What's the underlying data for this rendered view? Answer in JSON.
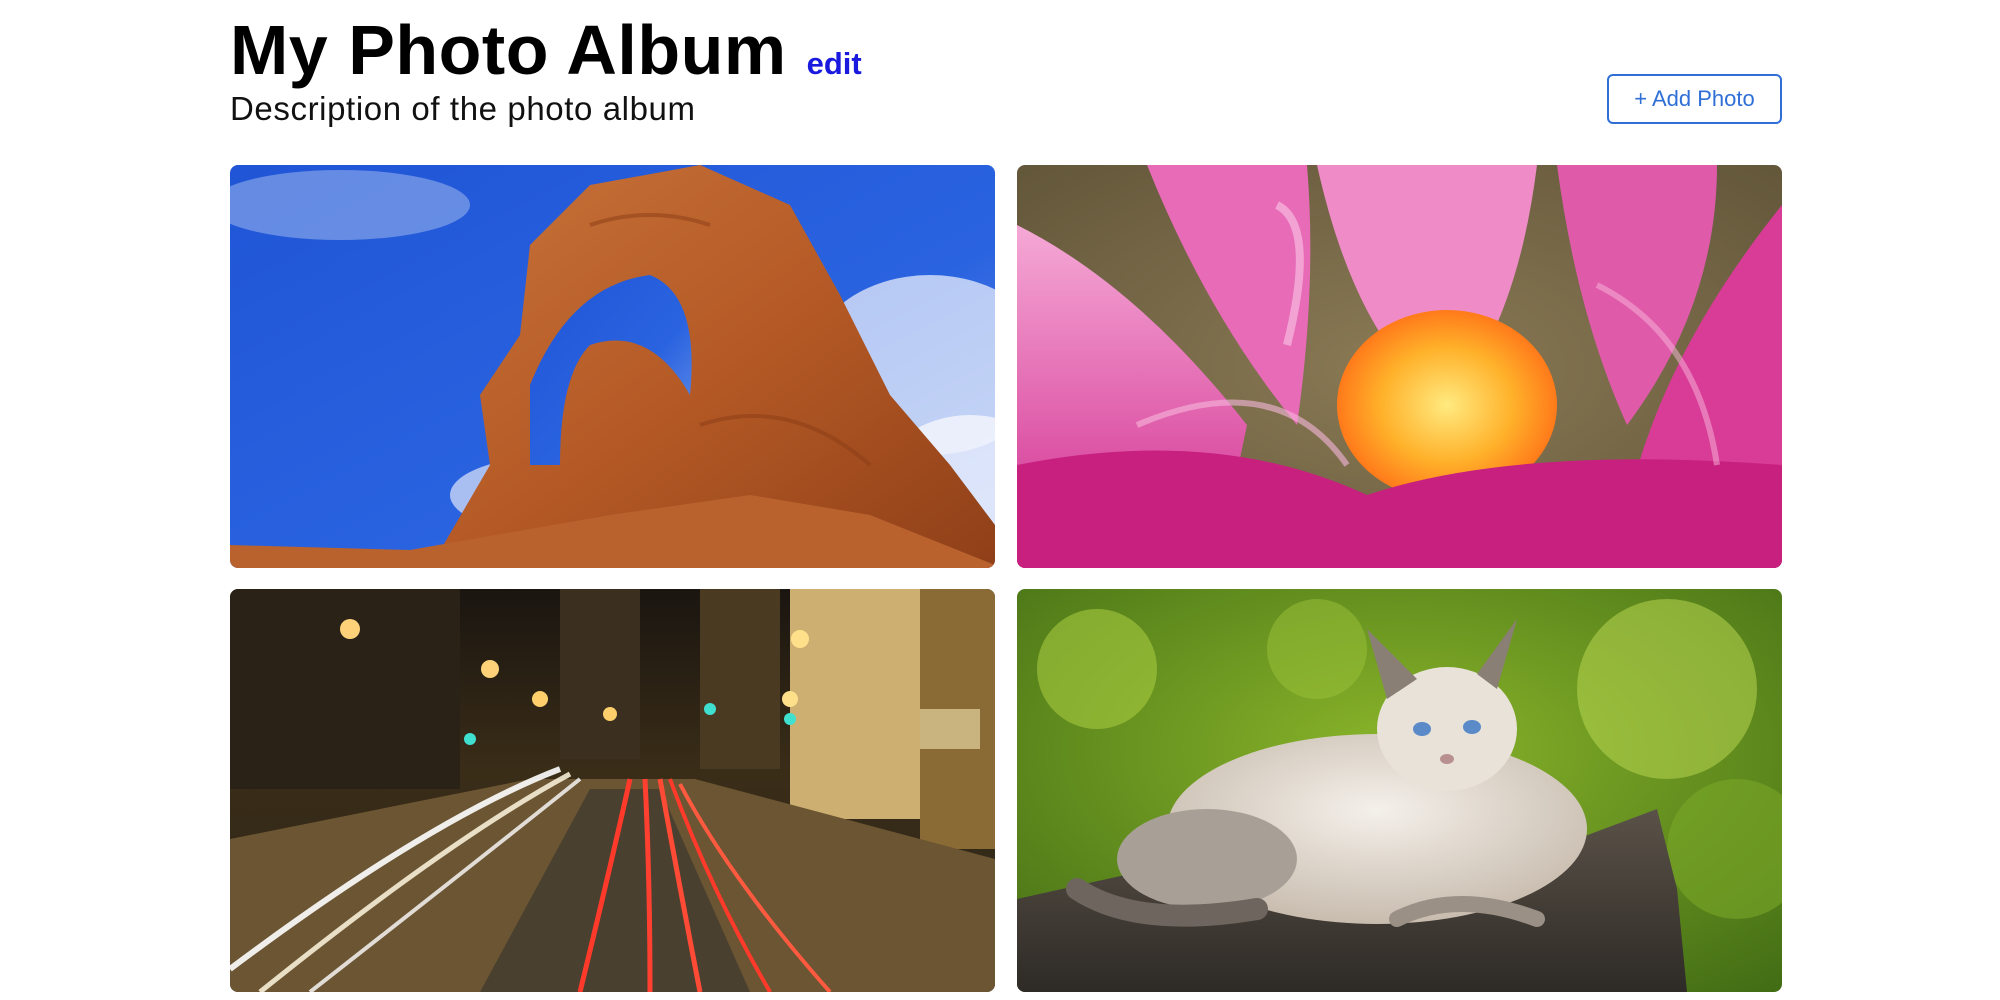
{
  "album": {
    "title": "My Photo Album",
    "edit_label": "edit",
    "description": "Description of the photo album"
  },
  "toolbar": {
    "add_photo_label": "+ Add Photo"
  },
  "photos": [
    {
      "subject": "red rock arch under blue sky"
    },
    {
      "subject": "pink lotus flower close-up"
    },
    {
      "subject": "city street at night with light trails"
    },
    {
      "subject": "siamese cat lying on tree stump"
    }
  ],
  "colors": {
    "edit_link": "#1a1adf",
    "button_accent": "#2f6fd6"
  }
}
